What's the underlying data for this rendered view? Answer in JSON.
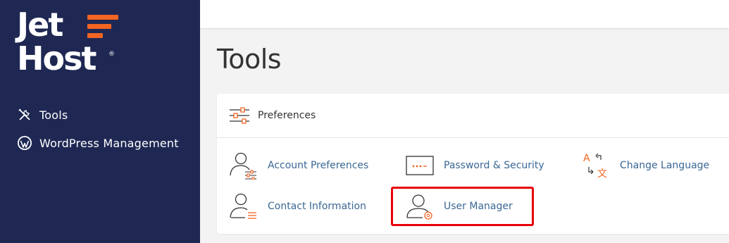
{
  "brand": {
    "line1": "Jet",
    "line2": "Host",
    "registered": "®",
    "accent": "#f26522",
    "sidebar_bg": "#1f2853"
  },
  "sidebar": {
    "items": [
      {
        "label": "Tools",
        "icon": "tools-icon"
      },
      {
        "label": "WordPress Management",
        "icon": "wordpress-icon"
      }
    ]
  },
  "page": {
    "title": "Tools"
  },
  "panel": {
    "title": "Preferences",
    "icon": "sliders-icon",
    "tools": [
      {
        "label": "Account Preferences",
        "icon": "account-preferences-icon"
      },
      {
        "label": "Password & Security",
        "icon": "password-security-icon"
      },
      {
        "label": "Change Language",
        "icon": "change-language-icon"
      },
      {
        "label": "Contact Information",
        "icon": "contact-information-icon"
      },
      {
        "label": "User Manager",
        "icon": "user-manager-icon",
        "highlighted": true
      }
    ]
  },
  "colors": {
    "link": "#3a6794",
    "highlight": "#e8000b",
    "icon_accent": "#f26522"
  }
}
